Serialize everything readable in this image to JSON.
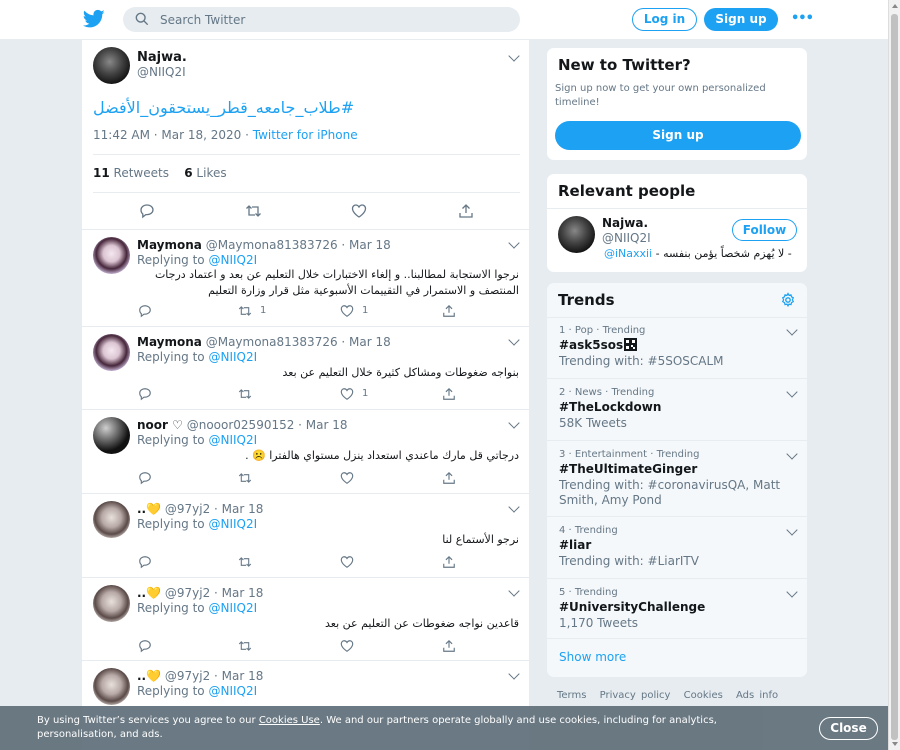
{
  "header": {
    "search_placeholder": "Search Twitter",
    "login_label": "Log in",
    "signup_label": "Sign up",
    "more_label": "•••"
  },
  "tweet": {
    "author_name": "Najwa.",
    "author_handle": "@NIIQ2I",
    "text": "#طلاب_جامعه_قطر_يستحقون_الأفضل",
    "time": "11:42 AM · Mar 18, 2020",
    "source": "Twitter for iPhone",
    "retweets_count": "11",
    "retweets_label": "Retweets",
    "likes_count": "6",
    "likes_label": "Likes"
  },
  "replies": [
    {
      "name": "Maymona",
      "handle": "@Maymona81383726 · Mar 18",
      "replying_label": "Replying to",
      "replying_to": "@NIIQ2I",
      "text": "نرجوا الاستجابة لمطالبنا.. و إلغاء الاختبارات خلال التعليم عن بعد و اعتماد درجات المنتصف و الاستمرار في التقييمات الأسبوعية مثل قرار وزارة التعليم",
      "retweets": "1",
      "likes": "1"
    },
    {
      "name": "Maymona",
      "handle": "@Maymona81383726 · Mar 18",
      "replying_label": "Replying to",
      "replying_to": "@NIIQ2I",
      "text": "بنواجه ضغوطات ومشاكل كثيرة خلال التعليم عن بعد",
      "retweets": "",
      "likes": "1"
    },
    {
      "name": "noor ♡",
      "handle": "@nooor02590152 · Mar 18",
      "replying_label": "Replying to",
      "replying_to": "@NIIQ2I",
      "text": "درجاتي قل مارك ماعندي استعداد ينزل مستواي هالفترا ☹️ .",
      "retweets": "",
      "likes": ""
    },
    {
      "name": "..💛",
      "handle": "@97yj2 · Mar 18",
      "replying_label": "Replying to",
      "replying_to": "@NIIQ2I",
      "text": "نرجو الأستماع لنا",
      "retweets": "",
      "likes": ""
    },
    {
      "name": "..💛",
      "handle": "@97yj2 · Mar 18",
      "replying_label": "Replying to",
      "replying_to": "@NIIQ2I",
      "text": "قاعدين نواجه ضغوطات عن التعليم عن بعد",
      "retweets": "",
      "likes": ""
    },
    {
      "name": "..💛",
      "handle": "@97yj2 · Mar 18",
      "replying_label": "Replying to",
      "replying_to": "@NIIQ2I",
      "text": "",
      "retweets": "",
      "likes": ""
    }
  ],
  "new_to_twitter": {
    "title": "New to Twitter?",
    "description": "Sign up now to get your own personalized timeline!",
    "signup_label": "Sign up"
  },
  "relevant_people": {
    "title": "Relevant people",
    "name": "Najwa.",
    "handle": "@NIIQ2I",
    "follow_label": "Follow",
    "bio_text": "- لا يُهزم شخصاً يؤمن بنفسه -",
    "bio_link": "@iNaxxii"
  },
  "trends": {
    "title": "Trends",
    "items": [
      {
        "meta": "1 · Pop · Trending",
        "title": "#ask5sos",
        "sub": "Trending with: #5SOSCALM"
      },
      {
        "meta": "2 · News · Trending",
        "title": "#TheLockdown",
        "sub": "58K Tweets"
      },
      {
        "meta": "3 · Entertainment · Trending",
        "title": "#TheUltimateGinger",
        "sub": "Trending with: #coronavirusQA, Matt Smith, Amy Pond"
      },
      {
        "meta": "4 · Trending",
        "title": "#liar",
        "sub": "Trending with: #LiarITV"
      },
      {
        "meta": "5 · Trending",
        "title": "#UniversityChallenge",
        "sub": "1,170 Tweets"
      }
    ],
    "show_more": "Show more"
  },
  "footer": {
    "terms": "Terms",
    "privacy": "Privacy policy",
    "cookies": "Cookies",
    "ads": "Ads info"
  },
  "cookie_banner": {
    "text_before": "By using Twitter’s services you agree to our",
    "link": "Cookies Use",
    "text_after": ". We and our partners operate globally and use cookies, including for analytics, personalisation, and ads.",
    "close_label": "Close"
  },
  "colors": {
    "accent": "#1da1f2",
    "muted": "#657786",
    "background": "#e6ecf0",
    "cookie_banner": "#66757f"
  }
}
